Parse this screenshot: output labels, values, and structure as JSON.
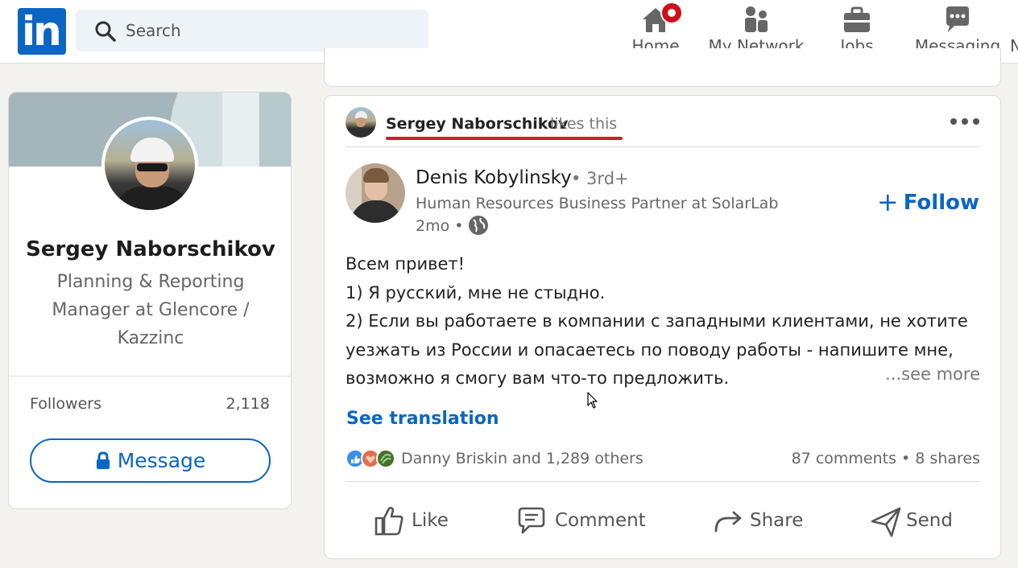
{
  "nav": {
    "search_placeholder": "Search",
    "items": [
      {
        "label": "Home",
        "icon": "home-icon"
      },
      {
        "label": "My Network",
        "icon": "network-icon"
      },
      {
        "label": "Jobs",
        "icon": "briefcase-icon"
      },
      {
        "label": "Messaging",
        "icon": "messaging-icon"
      }
    ],
    "partial_item_initial": "N",
    "notification_color": "#cc1016",
    "brand_color": "#0a66c2"
  },
  "profile_card": {
    "name": "Sergey Naborschikov",
    "headline": "Planning & Reporting Manager at Glencore / Kazzinc",
    "followers_label": "Followers",
    "followers_count": "2,118",
    "message_button": "Message"
  },
  "post": {
    "liker_name": "Sergey Naborschikov",
    "liker_action": "likes this",
    "author_name": "Denis Kobylinsky",
    "author_degree": "• 3rd+",
    "author_headline": "Human Resources Business Partner at SolarLab",
    "time": "2mo •",
    "follow_label": "Follow",
    "text_lines": [
      "Всем привет!",
      "1) Я русский, мне не стыдно.",
      "2) Если вы работаете в компании с западными клиентами, не хотите",
      "уезжать из России и опасаетесь по поводу работы - напишите мне,",
      "возможно я смогу вам что-то предложить."
    ],
    "see_more": "...see more",
    "see_translation": "See translation",
    "reactors": "Danny Briskin and 1,289 others",
    "stats": "87 comments • 8 shares",
    "actions": {
      "like": "Like",
      "comment": "Comment",
      "share": "Share",
      "send": "Send"
    },
    "highlight_color": "#d01b2a"
  }
}
